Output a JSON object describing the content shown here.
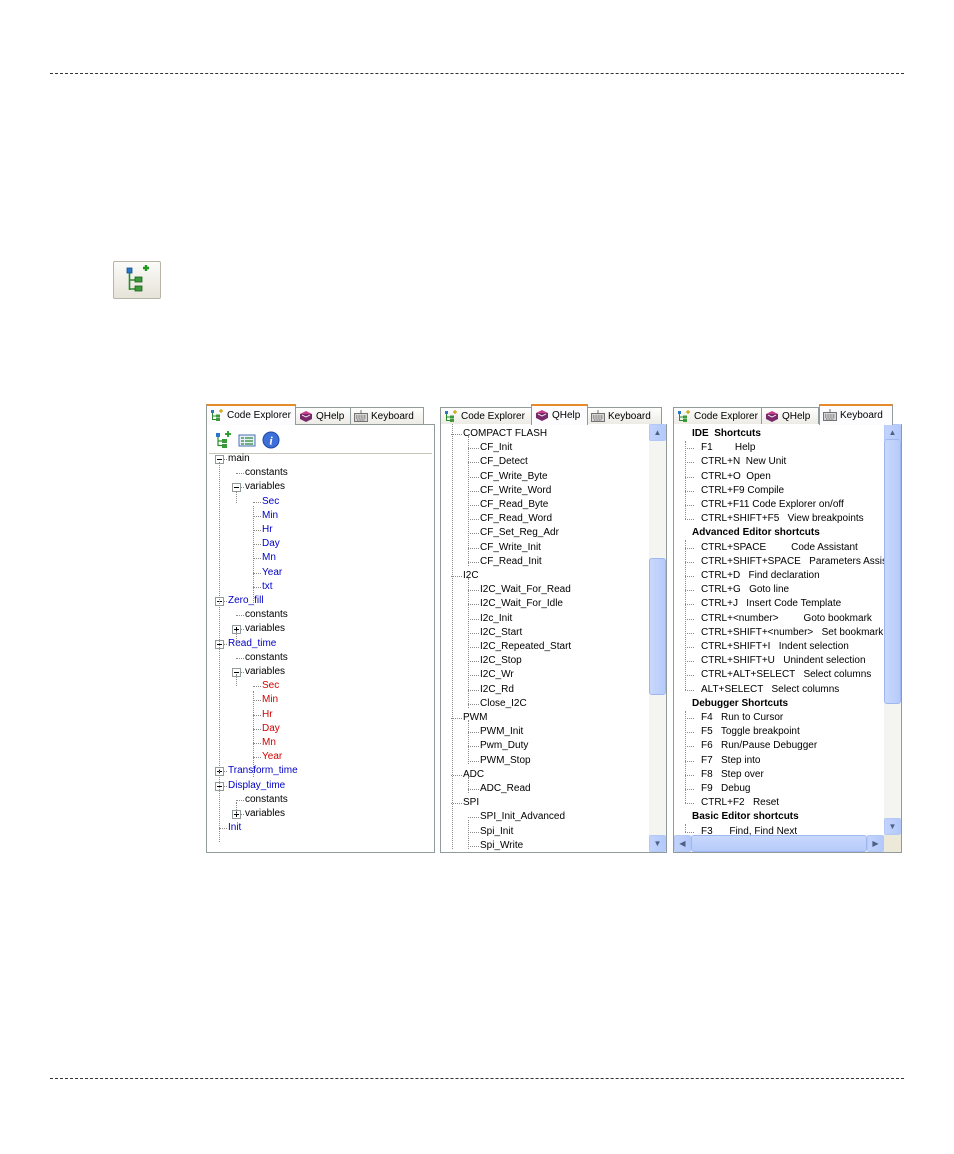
{
  "panels": {
    "code_explorer": {
      "tabs": [
        "Code Explorer",
        "QHelp",
        "Keyboard"
      ],
      "active_tab": 0,
      "tree": [
        {
          "label": "main",
          "level": 0,
          "expander": "minus",
          "color": "black"
        },
        {
          "label": "constants",
          "level": 1,
          "expander": "none",
          "color": "black"
        },
        {
          "label": "variables",
          "level": 1,
          "expander": "minus",
          "color": "black"
        },
        {
          "label": "Sec",
          "level": 2,
          "expander": "none",
          "color": "blue"
        },
        {
          "label": "Min",
          "level": 2,
          "expander": "none",
          "color": "blue"
        },
        {
          "label": "Hr",
          "level": 2,
          "expander": "none",
          "color": "blue"
        },
        {
          "label": "Day",
          "level": 2,
          "expander": "none",
          "color": "blue"
        },
        {
          "label": "Mn",
          "level": 2,
          "expander": "none",
          "color": "blue"
        },
        {
          "label": "Year",
          "level": 2,
          "expander": "none",
          "color": "blue"
        },
        {
          "label": "txt",
          "level": 2,
          "expander": "none",
          "color": "blue"
        },
        {
          "label": "Zero_fill",
          "level": 0,
          "expander": "minus",
          "color": "blue"
        },
        {
          "label": "constants",
          "level": 1,
          "expander": "none",
          "color": "black"
        },
        {
          "label": "variables",
          "level": 1,
          "expander": "plus",
          "color": "black"
        },
        {
          "label": "Read_time",
          "level": 0,
          "expander": "minus",
          "color": "blue"
        },
        {
          "label": "constants",
          "level": 1,
          "expander": "none",
          "color": "black"
        },
        {
          "label": "variables",
          "level": 1,
          "expander": "minus",
          "color": "black"
        },
        {
          "label": "Sec",
          "level": 2,
          "expander": "none",
          "color": "red"
        },
        {
          "label": "Min",
          "level": 2,
          "expander": "none",
          "color": "red"
        },
        {
          "label": "Hr",
          "level": 2,
          "expander": "none",
          "color": "red"
        },
        {
          "label": "Day",
          "level": 2,
          "expander": "none",
          "color": "red"
        },
        {
          "label": "Mn",
          "level": 2,
          "expander": "none",
          "color": "red"
        },
        {
          "label": "Year",
          "level": 2,
          "expander": "none",
          "color": "red"
        },
        {
          "label": "Transform_time",
          "level": 0,
          "expander": "plus",
          "color": "blue"
        },
        {
          "label": "Display_time",
          "level": 0,
          "expander": "minus",
          "color": "blue"
        },
        {
          "label": "constants",
          "level": 1,
          "expander": "none",
          "color": "black"
        },
        {
          "label": "variables",
          "level": 1,
          "expander": "plus",
          "color": "black"
        },
        {
          "label": "Init",
          "level": 0,
          "expander": "none",
          "color": "blue"
        }
      ]
    },
    "qhelp": {
      "tabs": [
        "Code Explorer",
        "QHelp",
        "Keyboard"
      ],
      "active_tab": 1,
      "tree": [
        {
          "label": "COMPACT FLASH",
          "level": 0
        },
        {
          "label": "CF_Init",
          "level": 1
        },
        {
          "label": "CF_Detect",
          "level": 1
        },
        {
          "label": "CF_Write_Byte",
          "level": 1
        },
        {
          "label": "CF_Write_Word",
          "level": 1
        },
        {
          "label": "CF_Read_Byte",
          "level": 1
        },
        {
          "label": "CF_Read_Word",
          "level": 1
        },
        {
          "label": "CF_Set_Reg_Adr",
          "level": 1
        },
        {
          "label": "CF_Write_Init",
          "level": 1
        },
        {
          "label": "CF_Read_Init",
          "level": 1
        },
        {
          "label": "I2C",
          "level": 0
        },
        {
          "label": "I2C_Wait_For_Read",
          "level": 1
        },
        {
          "label": "I2C_Wait_For_Idle",
          "level": 1
        },
        {
          "label": "I2c_Init",
          "level": 1
        },
        {
          "label": "I2C_Start",
          "level": 1
        },
        {
          "label": "I2C_Repeated_Start",
          "level": 1
        },
        {
          "label": "I2C_Stop",
          "level": 1
        },
        {
          "label": "I2C_Wr",
          "level": 1
        },
        {
          "label": "I2C_Rd",
          "level": 1
        },
        {
          "label": "Close_I2C",
          "level": 1
        },
        {
          "label": "PWM",
          "level": 0
        },
        {
          "label": "PWM_Init",
          "level": 1
        },
        {
          "label": "Pwm_Duty",
          "level": 1
        },
        {
          "label": "PWM_Stop",
          "level": 1
        },
        {
          "label": "ADC",
          "level": 0
        },
        {
          "label": "ADC_Read",
          "level": 1
        },
        {
          "label": "SPI",
          "level": 0
        },
        {
          "label": "SPI_Init_Advanced",
          "level": 1
        },
        {
          "label": "Spi_Init",
          "level": 1
        },
        {
          "label": "Spi_Write",
          "level": 1
        }
      ]
    },
    "keyboard": {
      "tabs": [
        "Code Explorer",
        "QHelp",
        "Keyboard"
      ],
      "active_tab": 2,
      "tree": [
        {
          "label": "IDE  Shortcuts",
          "level": 0,
          "bold": true
        },
        {
          "label": "F1        Help",
          "level": 1
        },
        {
          "label": "CTRL+N  New Unit",
          "level": 1
        },
        {
          "label": "CTRL+O  Open",
          "level": 1
        },
        {
          "label": "CTRL+F9 Compile",
          "level": 1
        },
        {
          "label": "CTRL+F11 Code Explorer on/off",
          "level": 1
        },
        {
          "label": "CTRL+SHIFT+F5   View breakpoints",
          "level": 1
        },
        {
          "label": "Advanced Editor shortcuts",
          "level": 0,
          "bold": true
        },
        {
          "label": "CTRL+SPACE         Code Assistant",
          "level": 1
        },
        {
          "label": "CTRL+SHIFT+SPACE   Parameters Assistant",
          "level": 1
        },
        {
          "label": "CTRL+D   Find declaration",
          "level": 1
        },
        {
          "label": "CTRL+G   Goto line",
          "level": 1
        },
        {
          "label": "CTRL+J   Insert Code Template",
          "level": 1
        },
        {
          "label": "CTRL+<number>         Goto bookmark",
          "level": 1
        },
        {
          "label": "CTRL+SHIFT+<number>   Set bookmark",
          "level": 1
        },
        {
          "label": "CTRL+SHIFT+I   Indent selection",
          "level": 1
        },
        {
          "label": "CTRL+SHIFT+U   Unindent selection",
          "level": 1
        },
        {
          "label": "CTRL+ALT+SELECT   Select columns",
          "level": 1
        },
        {
          "label": "ALT+SELECT   Select columns",
          "level": 1
        },
        {
          "label": "Debugger Shortcuts",
          "level": 0,
          "bold": true
        },
        {
          "label": "F4   Run to Cursor",
          "level": 1
        },
        {
          "label": "F5   Toggle breakpoint",
          "level": 1
        },
        {
          "label": "F6   Run/Pause Debugger",
          "level": 1
        },
        {
          "label": "F7   Step into",
          "level": 1
        },
        {
          "label": "F8   Step over",
          "level": 1
        },
        {
          "label": "F9   Debug",
          "level": 1
        },
        {
          "label": "CTRL+F2   Reset",
          "level": 1
        },
        {
          "label": "Basic Editor shortcuts",
          "level": 0,
          "bold": true
        },
        {
          "label": "F3      Find, Find Next",
          "level": 1
        }
      ]
    }
  },
  "colors": {
    "blue": "#0000c8",
    "red": "#d40000",
    "black": "#000000"
  }
}
